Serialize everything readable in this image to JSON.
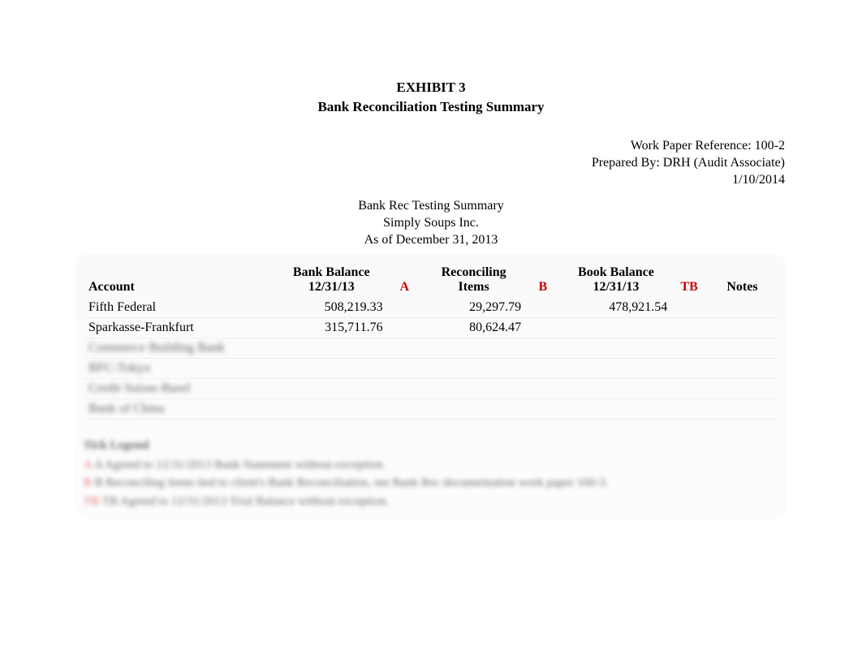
{
  "header": {
    "exhibit": "EXHIBIT 3",
    "subtitle": "Bank Reconciliation Testing Summary"
  },
  "meta": {
    "wp_ref": "Work Paper Reference: 100-2",
    "prepared_by": "Prepared By: DRH (Audit Associate)",
    "date": "1/10/2014"
  },
  "center_info": {
    "line1": "Bank Rec Testing Summary",
    "line2": "Simply Soups Inc.",
    "line3": "As of December 31, 2013"
  },
  "columns": {
    "account": "Account",
    "bank_balance_l1": "Bank Balance",
    "bank_balance_l2": "12/31/13",
    "a": "A",
    "reconciling_l1": "Reconciling",
    "reconciling_l2": "Items",
    "b": "B",
    "book_balance_l1": "Book Balance",
    "book_balance_l2": "12/31/13",
    "tb": "TB",
    "notes": "Notes"
  },
  "rows": [
    {
      "account": "Fifth Federal",
      "bank": "508,219.33",
      "a": "",
      "rec": "29,297.79",
      "rec_red": false,
      "b": "",
      "book": "478,921.54",
      "tb": "",
      "notes": "",
      "blurred": false
    },
    {
      "account": "Sparkasse-Frankfurt",
      "bank": "315,711.76",
      "a": "",
      "rec": "80,624.47",
      "rec_red": false,
      "b": "",
      "book": "",
      "tb": "",
      "notes": "",
      "blurred": false
    },
    {
      "account": "Commerce Building Bank",
      "bank": "",
      "a": "",
      "rec": "",
      "rec_red": true,
      "b": "",
      "book": "",
      "tb": "",
      "notes": "",
      "blurred": true
    },
    {
      "account": "BFC-Tokyo",
      "bank": "",
      "a": "",
      "rec": "",
      "rec_red": false,
      "b": "",
      "book": "",
      "tb": "",
      "notes": "",
      "blurred": true
    },
    {
      "account": "Credit Suisse-Basel",
      "bank": "",
      "a": "",
      "rec": "",
      "rec_red": false,
      "b": "",
      "book": "",
      "tb": "",
      "notes": "",
      "blurred": true
    },
    {
      "account": "Bank of China",
      "bank": "",
      "a": "",
      "rec": "",
      "rec_red": true,
      "b": "",
      "book": "",
      "tb": "",
      "notes": "",
      "blurred": true
    }
  ],
  "legend": {
    "title": "Tick Legend",
    "line_a": "A Agreed to 12/31/2013 Bank Statement without exception.",
    "line_b": "B Reconciling items tied to client's Bank Reconciliation, see Bank Rec documentation work paper 100-3.",
    "line_tb": "TB Agreed to 12/31/2013 Trial Balance without exception."
  }
}
